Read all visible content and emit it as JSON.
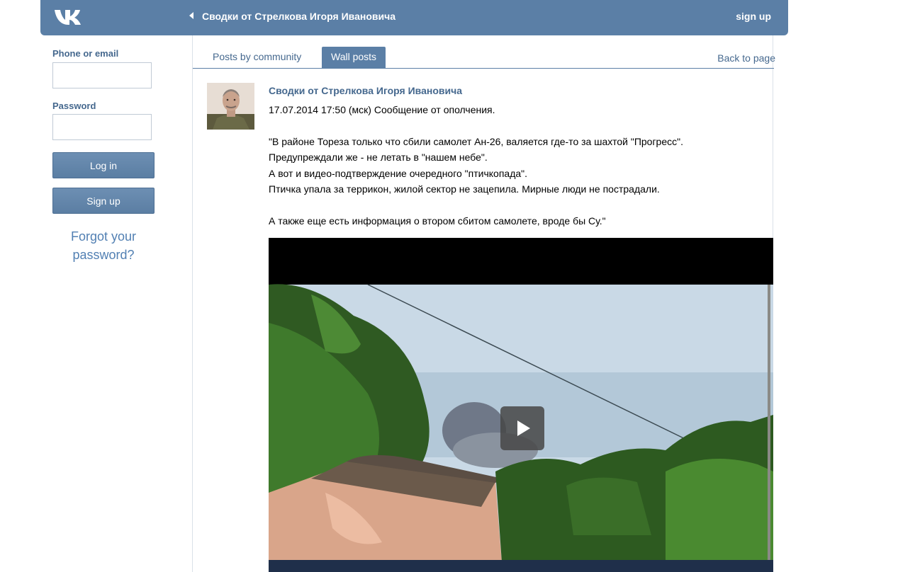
{
  "header": {
    "logo_icon": "vk-logo-icon",
    "back_icon": "back-arrow-icon",
    "title": "Сводки от Стрелкова Игоря Ивановича",
    "signup": "sign up",
    "bg_color": "#5b7fa6"
  },
  "login": {
    "phone_label": "Phone or email",
    "phone_value": "",
    "password_label": "Password",
    "password_value": "",
    "login_button": "Log in",
    "signup_button": "Sign up",
    "forgot": "Forgot your password?"
  },
  "tabs": {
    "posts_by_community": "Posts by community",
    "wall_posts": "Wall posts",
    "back_to_page": "Back to page"
  },
  "post": {
    "author": "Сводки от Стрелкова Игоря Ивановича",
    "lines": [
      "17.07.2014 17:50 (мск) Сообщение от ополчения.",
      "",
      "\"В районе Тореза только что сбили самолет Ан-26, валяется где-то за шахтой \"Прогресс\".",
      "Предупреждали же - не летать в \"нашем небе\".",
      "А вот и видео-подтверждение очередного \"птичкопада\".",
      "Птичка упала за террикон, жилой сектор не зацепила. Мирные люди не пострадали.",
      "",
      "А также еще есть информация о втором сбитом самолете, вроде бы Су.\""
    ],
    "video_play_icon": "play-icon"
  },
  "colors": {
    "link": "#45688e",
    "accent": "#5b7fa6",
    "forgot_link": "#5280b3"
  }
}
